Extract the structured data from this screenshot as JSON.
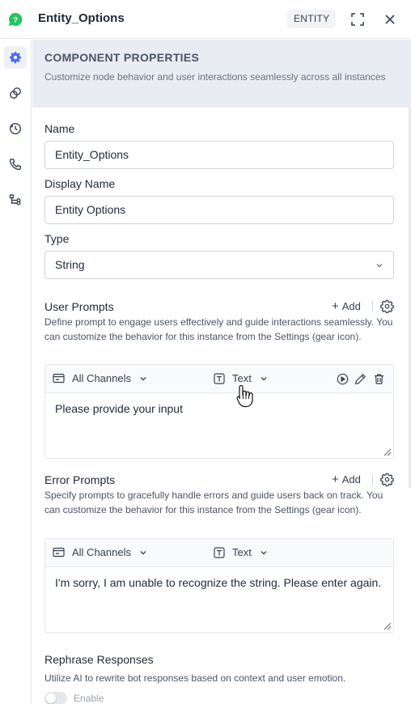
{
  "header": {
    "title": "Entity_Options",
    "badge": "ENTITY",
    "logo_icon": "question-bubble-icon",
    "expand_icon": "expand-icon",
    "close_icon": "close-icon"
  },
  "sidebar": {
    "items": [
      {
        "name": "settings",
        "icon": "gear-icon",
        "active": true
      },
      {
        "name": "connections",
        "icon": "link-circles-icon",
        "active": false
      },
      {
        "name": "history",
        "icon": "history-icon",
        "active": false
      },
      {
        "name": "voice",
        "icon": "phone-icon",
        "active": false
      },
      {
        "name": "transitions",
        "icon": "flow-icon",
        "active": false
      }
    ]
  },
  "banner": {
    "title": "COMPONENT PROPERTIES",
    "description": "Customize node behavior and user interactions seamlessly across all instances"
  },
  "fields": {
    "name_label": "Name",
    "name_value": "Entity_Options",
    "display_name_label": "Display Name",
    "display_name_value": "Entity Options",
    "type_label": "Type",
    "type_value": "String"
  },
  "user_prompts": {
    "title": "User Prompts",
    "add_label": "Add",
    "description": "Define prompt to engage users effectively and guide interactions seamlessly. You can customize the behavior for this instance from the Settings (gear icon).",
    "channel": "All Channels",
    "format": "Text",
    "text": "Please provide your input"
  },
  "error_prompts": {
    "title": "Error Prompts",
    "add_label": "Add",
    "description": "Specify prompts to gracefully handle errors and guide users back on track. You can customize the behavior for this instance from the Settings (gear icon).",
    "channel": "All Channels",
    "format": "Text",
    "text": "I'm sorry, I am unable to recognize the string. Please enter again."
  },
  "rephrase": {
    "title": "Rephrase Responses",
    "description": "Utilize AI to rewrite bot responses based on context and user emotion.",
    "toggle_label": "Enable",
    "enabled": false
  },
  "colors": {
    "accent": "#4f6bed",
    "logo": "#22c55e",
    "banner_bg": "#e9ecf3"
  }
}
